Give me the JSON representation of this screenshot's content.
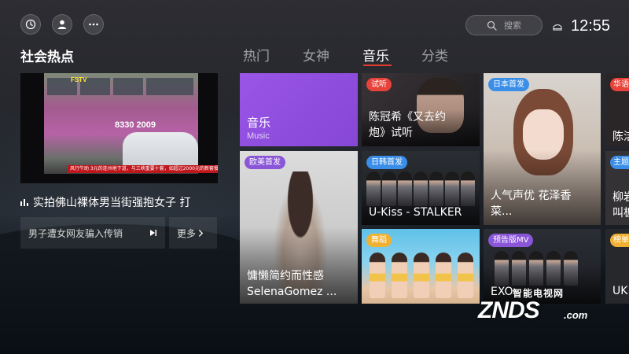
{
  "top_bar": {
    "icons": [
      "history-icon",
      "user-icon",
      "more-icon"
    ],
    "search_placeholder": "搜索",
    "clock": "12:55"
  },
  "section_title": "社会热点",
  "tabs": [
    {
      "label": "热门",
      "active": false
    },
    {
      "label": "女神",
      "active": false
    },
    {
      "label": "音乐",
      "active": true
    },
    {
      "label": "分类",
      "active": false
    }
  ],
  "accent_color": "#e63a2e",
  "news": {
    "video": {
      "logo": "FSTV",
      "phone_number": "8330 2009",
      "ticker": "风行牛助 3元的连州地下道，与三峡重要十套，如超过2000元的新套餐"
    },
    "headline": "实拍佛山裸体男当街强抱女子 打",
    "sub_item": "男子遭女网友骗入传销",
    "more_label": "更多"
  },
  "tiles": {
    "music": {
      "title": "音乐",
      "subtitle": "Music",
      "color": "#9452e2"
    },
    "selena": {
      "tag": "欧美首发",
      "tag_color": "#8a55d8",
      "title_lines": [
        "慵懒简约而性感",
        "SelenaGomez ..."
      ]
    },
    "chen": {
      "tag": "试听",
      "tag_color": "#e8433a",
      "title_lines": [
        "陈冠希《又去约",
        "炮》试听"
      ]
    },
    "ukiss": {
      "tag": "日韩首发",
      "tag_color": "#3b8ee8",
      "title": "U-Kiss - STALKER"
    },
    "dance": {
      "tag": "舞蹈",
      "tag_color": "#f0b032"
    },
    "anime": {
      "tag": "日本首发",
      "tag_color": "#3b8ee8",
      "title_lines": [
        "人气声优 花泽香",
        "菜..."
      ]
    },
    "exo": {
      "tag": "预告版MV",
      "tag_color": "#8a55d8",
      "title": "EXO"
    },
    "edge": [
      {
        "tag": "华语",
        "tag_color": "#e8433a",
        "title": "陈洁"
      },
      {
        "tag": "主题",
        "tag_color": "#3b8ee8",
        "title_lines": [
          "柳岩",
          "叫板"
        ]
      },
      {
        "tag": "榜单",
        "tag_color": "#f0b032",
        "title": "UK"
      }
    ]
  },
  "watermark": {
    "sub": "智能电视网",
    "main": "ZNDS",
    "suffix": ".com"
  }
}
